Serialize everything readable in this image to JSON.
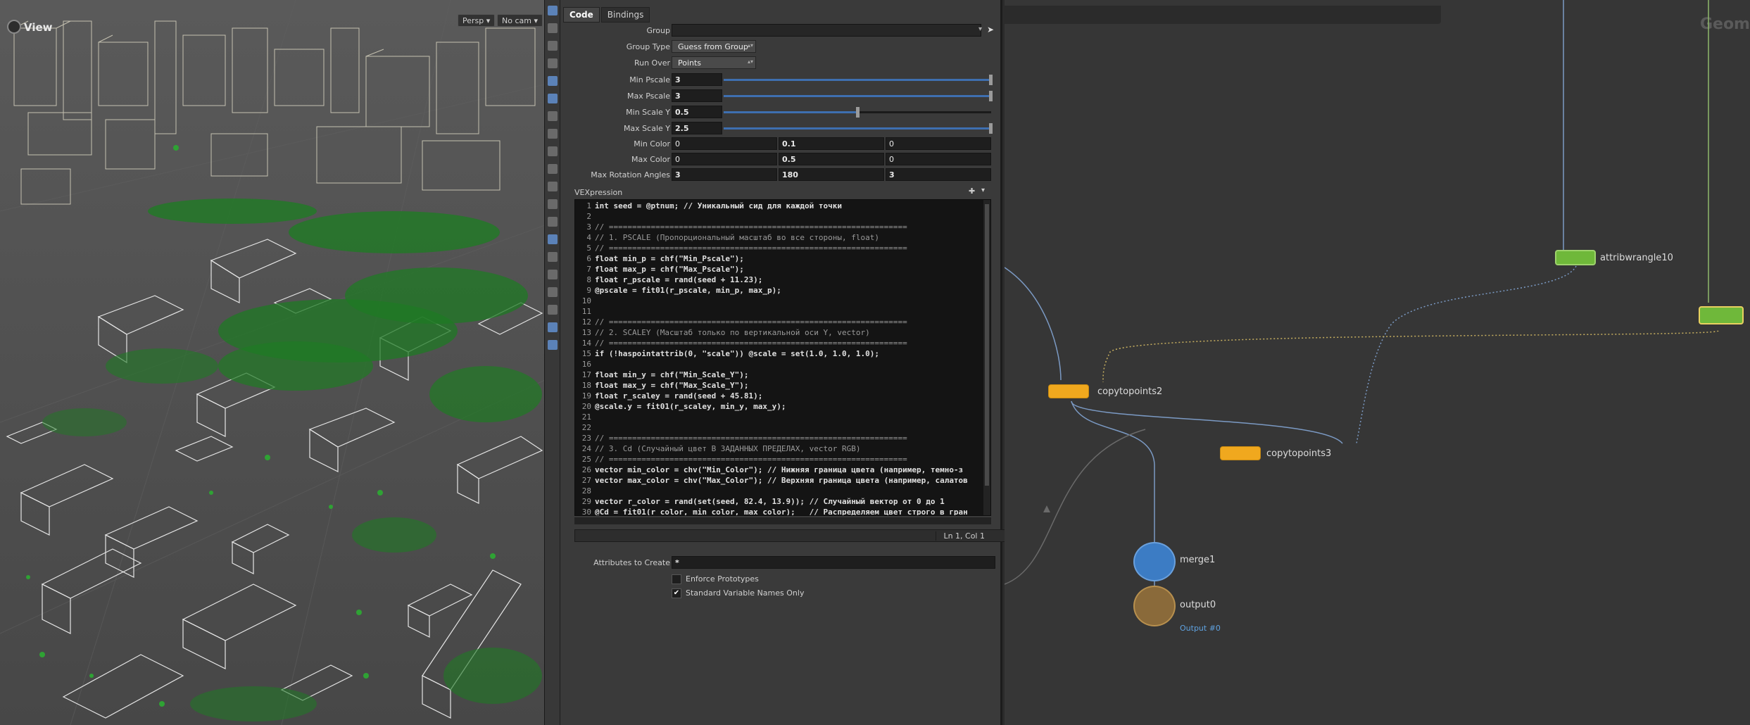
{
  "viewport": {
    "title": "View",
    "persp_label": "Persp ▾",
    "cam_label": "No cam ▾"
  },
  "params": {
    "tabs": [
      "Code",
      "Bindings"
    ],
    "group": {
      "label": "Group",
      "value": ""
    },
    "group_type": {
      "label": "Group Type",
      "value": "Guess from Group"
    },
    "run_over": {
      "label": "Run Over",
      "value": "Points"
    },
    "sliders": [
      {
        "label": "Min Pscale",
        "value": "3",
        "fill": 1.0
      },
      {
        "label": "Max Pscale",
        "value": "3",
        "fill": 1.0
      },
      {
        "label": "Min Scale Y",
        "value": "0.5",
        "fill": 0.5
      },
      {
        "label": "Max Scale Y",
        "value": "2.5",
        "fill": 1.0
      }
    ],
    "vectors": [
      {
        "label": "Min Color",
        "values": [
          "0",
          "0.1",
          "0"
        ]
      },
      {
        "label": "Max Color",
        "values": [
          "0",
          "0.5",
          "0"
        ]
      },
      {
        "label": "Max Rotation Angles",
        "values": [
          "3",
          "180",
          "3"
        ]
      }
    ],
    "vex_label": "VEXpression",
    "code": [
      {
        "n": "1",
        "t": "int seed = @ptnum; // Уникальный сид для каждой точки",
        "c": "tx"
      },
      {
        "n": "2",
        "t": "",
        "c": "tx"
      },
      {
        "n": "3",
        "t": "// ================================================================",
        "c": "tx cm"
      },
      {
        "n": "4",
        "t": "// 1. PSCALE (Пропорциональный масштаб во все стороны, float)",
        "c": "tx cm"
      },
      {
        "n": "5",
        "t": "// ================================================================",
        "c": "tx cm"
      },
      {
        "n": "6",
        "t": "float min_p = chf(\"Min_Pscale\");",
        "c": "tx"
      },
      {
        "n": "7",
        "t": "float max_p = chf(\"Max_Pscale\");",
        "c": "tx"
      },
      {
        "n": "8",
        "t": "float r_pscale = rand(seed + 11.23);",
        "c": "tx"
      },
      {
        "n": "9",
        "t": "@pscale = fit01(r_pscale, min_p, max_p);",
        "c": "tx"
      },
      {
        "n": "10",
        "t": "",
        "c": "tx"
      },
      {
        "n": "11",
        "t": "",
        "c": "tx"
      },
      {
        "n": "12",
        "t": "// ================================================================",
        "c": "tx cm"
      },
      {
        "n": "13",
        "t": "// 2. SCALEY (Масштаб только по вертикальной оси Y, vector)",
        "c": "tx cm"
      },
      {
        "n": "14",
        "t": "// ================================================================",
        "c": "tx cm"
      },
      {
        "n": "15",
        "t": "if (!haspointattrib(0, \"scale\")) @scale = set(1.0, 1.0, 1.0);",
        "c": "tx"
      },
      {
        "n": "16",
        "t": "",
        "c": "tx"
      },
      {
        "n": "17",
        "t": "float min_y = chf(\"Min_Scale_Y\");",
        "c": "tx"
      },
      {
        "n": "18",
        "t": "float max_y = chf(\"Max_Scale_Y\");",
        "c": "tx"
      },
      {
        "n": "19",
        "t": "float r_scaley = rand(seed + 45.81);",
        "c": "tx"
      },
      {
        "n": "20",
        "t": "@scale.y = fit01(r_scaley, min_y, max_y);",
        "c": "tx"
      },
      {
        "n": "21",
        "t": "",
        "c": "tx"
      },
      {
        "n": "22",
        "t": "",
        "c": "tx"
      },
      {
        "n": "23",
        "t": "// ================================================================",
        "c": "tx cm"
      },
      {
        "n": "24",
        "t": "// 3. Cd (Случайный цвет В ЗАДАННЫХ ПРЕДЕЛАХ, vector RGB)",
        "c": "tx cm"
      },
      {
        "n": "25",
        "t": "// ================================================================",
        "c": "tx cm"
      },
      {
        "n": "26",
        "t": "vector min_color = chv(\"Min_Color\"); // Нижняя граница цвета (например, темно-з",
        "c": "tx"
      },
      {
        "n": "27",
        "t": "vector max_color = chv(\"Max_Color\"); // Верхняя граница цвета (например, салатов",
        "c": "tx"
      },
      {
        "n": "28",
        "t": "",
        "c": "tx"
      },
      {
        "n": "29",
        "t": "vector r_color = rand(set(seed, 82.4, 13.9)); // Случайный вектор от 0 до 1",
        "c": "tx"
      },
      {
        "n": "30",
        "t": "@Cd = fit01(r_color, min_color, max_color);   // Распределяем цвет строго в гран",
        "c": "tx"
      }
    ],
    "cursor_status": "Ln 1, Col 1",
    "attributes_to_create": {
      "label": "Attributes to Create",
      "value": "*"
    },
    "enforce_prototypes": {
      "label": "Enforce Prototypes",
      "checked": false
    },
    "standard_names": {
      "label": "Standard Variable Names Only",
      "checked": true
    }
  },
  "network": {
    "context_title": "Geom",
    "nodes": {
      "attribwrangle10": "attribwrangle10",
      "copytopoints2": "copytopoints2",
      "copytopoints3": "copytopoints3",
      "merge1": "merge1",
      "output0": "output0",
      "output0_sub": "Output #0"
    }
  },
  "colors": {
    "wrangle_green": "#6fb83a",
    "copy_orange": "#f0a81e",
    "merge_blue": "#3c7cc4",
    "output_brown": "#8a6a3a",
    "accent_blue": "#3e6fb0"
  }
}
